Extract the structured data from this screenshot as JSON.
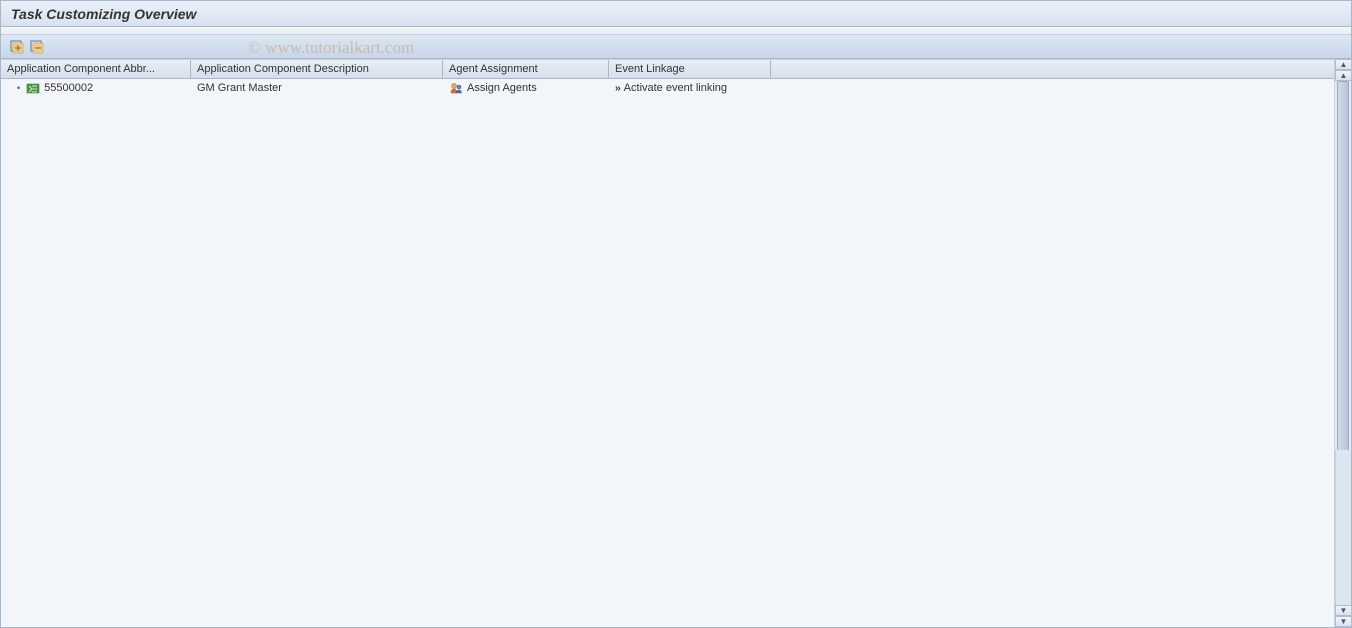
{
  "title": "Task Customizing Overview",
  "watermark": "© www.tutorialkart.com",
  "columns": {
    "c1": "Application Component Abbr...",
    "c2": "Application Component Description",
    "c3": "Agent Assignment",
    "c4": "Event Linkage"
  },
  "rows": [
    {
      "abbr": "55500002",
      "desc": "GM Grant Master",
      "agent": "Assign Agents",
      "event": "Activate event linking"
    }
  ]
}
